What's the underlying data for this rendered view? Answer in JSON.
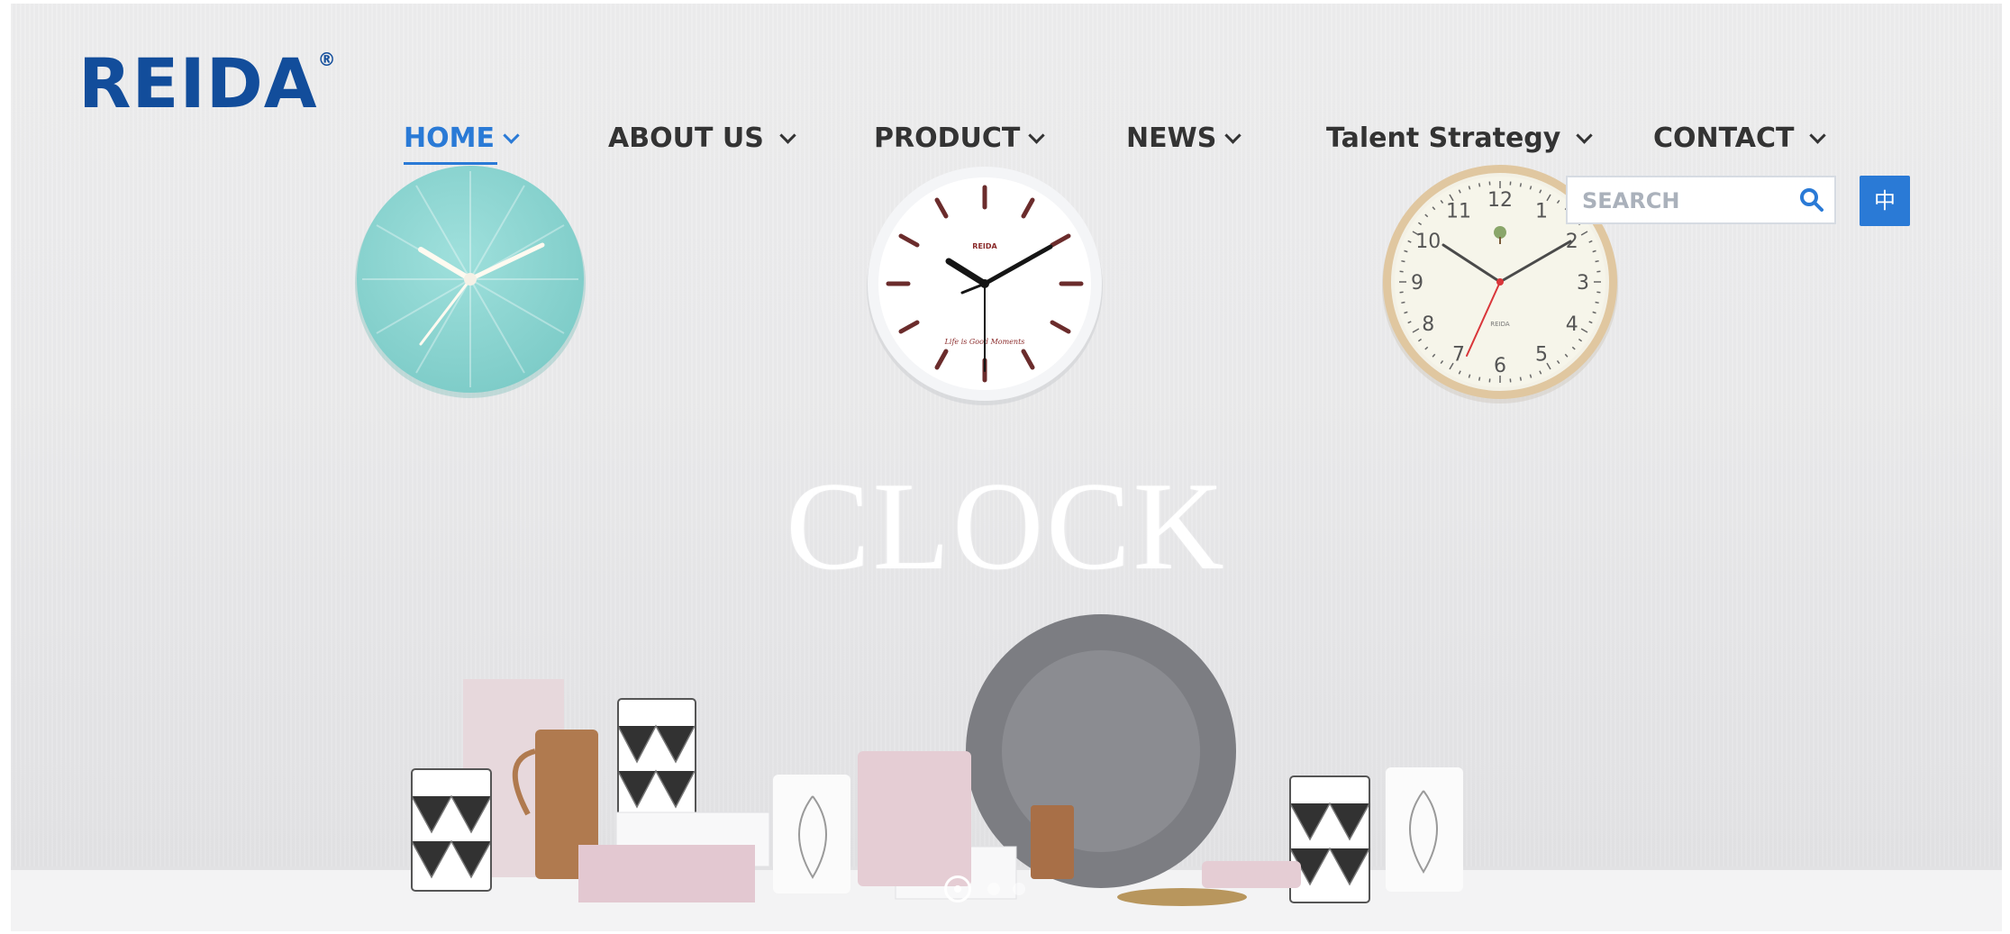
{
  "logo": {
    "text": "REIDA",
    "mark": "®"
  },
  "nav": {
    "items": [
      {
        "label": "HOME"
      },
      {
        "label": "ABOUT US"
      },
      {
        "label": "PRODUCT"
      },
      {
        "label": "NEWS"
      },
      {
        "label": "Talent Strategy"
      },
      {
        "label": "CONTACT"
      }
    ]
  },
  "search": {
    "placeholder": "SEARCH",
    "value": ""
  },
  "language": {
    "label": "中"
  },
  "hero": {
    "headline": "CLOCK"
  },
  "clocks": {
    "center_label_top": "REIDA",
    "center_label_bottom": "Life is Good Moments",
    "right_numbers": [
      "12",
      "1",
      "2",
      "3",
      "4",
      "5",
      "6",
      "7",
      "8",
      "9",
      "10",
      "11"
    ],
    "right_brand": "REIDA"
  },
  "slider": {
    "active_index": 0,
    "count": 3
  },
  "colors": {
    "accent": "#2a7ad6",
    "brand": "#124d9b",
    "nav_text": "#333333"
  }
}
